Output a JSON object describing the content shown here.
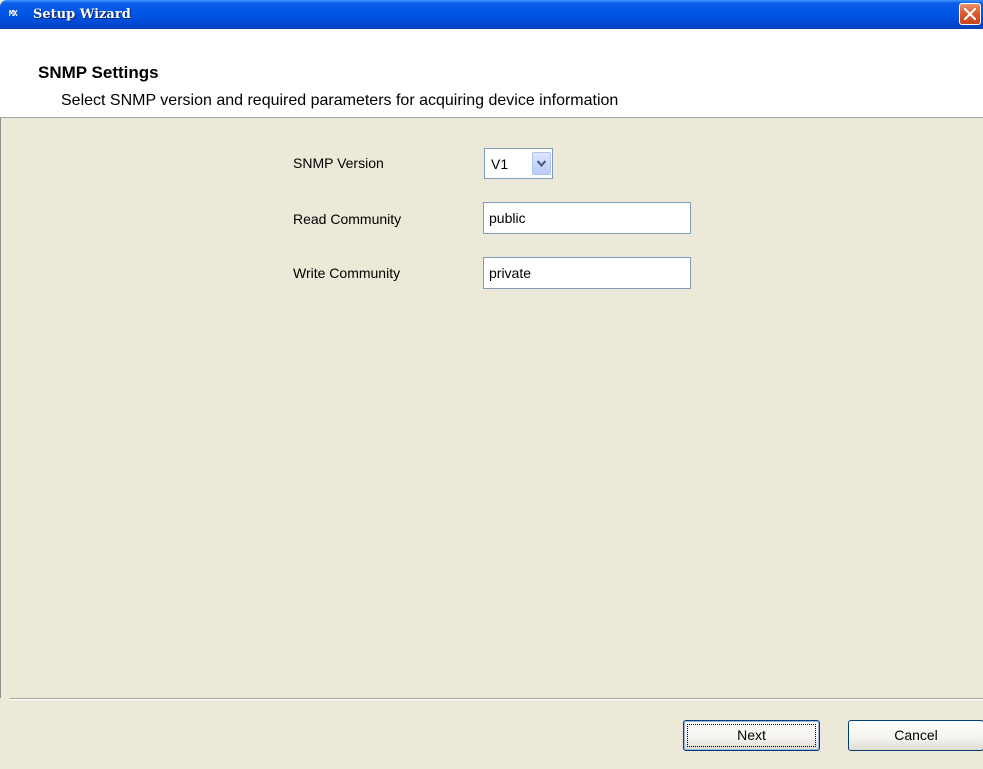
{
  "window": {
    "title": "Setup Wizard",
    "icon": "app-icon",
    "icon_text": "MX"
  },
  "header": {
    "title": "SNMP Settings",
    "subtitle": "Select SNMP version and required parameters for acquiring device information"
  },
  "form": {
    "snmp_version_label": "SNMP Version",
    "snmp_version_value": "V1",
    "read_community_label": "Read Community",
    "read_community_value": "public",
    "write_community_label": "Write Community",
    "write_community_value": "private"
  },
  "footer": {
    "next_label": "Next",
    "cancel_label": "Cancel"
  },
  "colors": {
    "titlebar": "#0055e5",
    "panel": "#ECE9D8",
    "close": "#de5a2b"
  }
}
